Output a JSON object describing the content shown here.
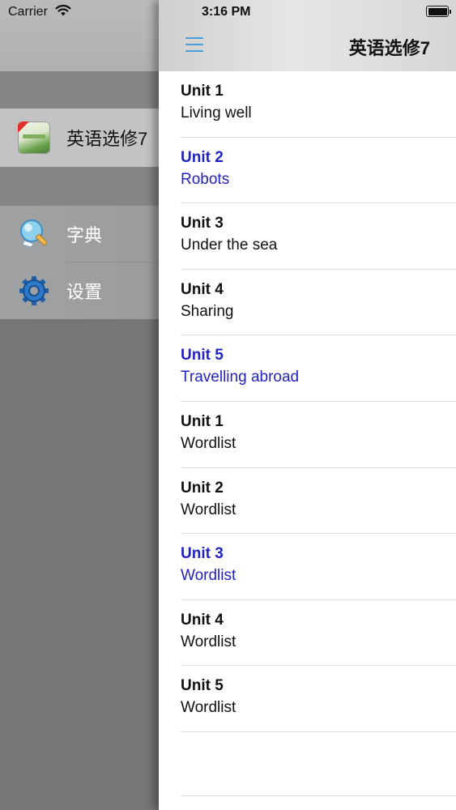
{
  "status_bar": {
    "carrier": "Carrier",
    "time": "3:16 PM",
    "wifi_icon": "wifi-icon",
    "battery_icon": "battery-icon"
  },
  "side_menu": {
    "book": {
      "label": "英语选修7",
      "icon": "book-cover-icon"
    },
    "items": [
      {
        "label": "字典",
        "icon": "dictionary-icon"
      },
      {
        "label": "设置",
        "icon": "gear-icon"
      }
    ]
  },
  "navbar": {
    "title": "英语选修7",
    "menu_icon": "hamburger-menu-icon",
    "accent": "#4a9fd8"
  },
  "lessons": [
    {
      "title": "Unit 1",
      "subtitle": "Living well"
    },
    {
      "title": "Unit 2",
      "subtitle": "Robots"
    },
    {
      "title": "Unit 3",
      "subtitle": "Under the sea"
    },
    {
      "title": "Unit 4",
      "subtitle": "Sharing"
    },
    {
      "title": "Unit 5",
      "subtitle": "Travelling abroad"
    },
    {
      "title": "Unit 1",
      "subtitle": "Wordlist"
    },
    {
      "title": "Unit 2",
      "subtitle": "Wordlist"
    },
    {
      "title": "Unit 3",
      "subtitle": "Wordlist"
    },
    {
      "title": "Unit 4",
      "subtitle": "Wordlist"
    },
    {
      "title": "Unit 5",
      "subtitle": "Wordlist"
    }
  ],
  "colors": {
    "highlight_text": "#2323c0",
    "normal_text": "#111111"
  }
}
